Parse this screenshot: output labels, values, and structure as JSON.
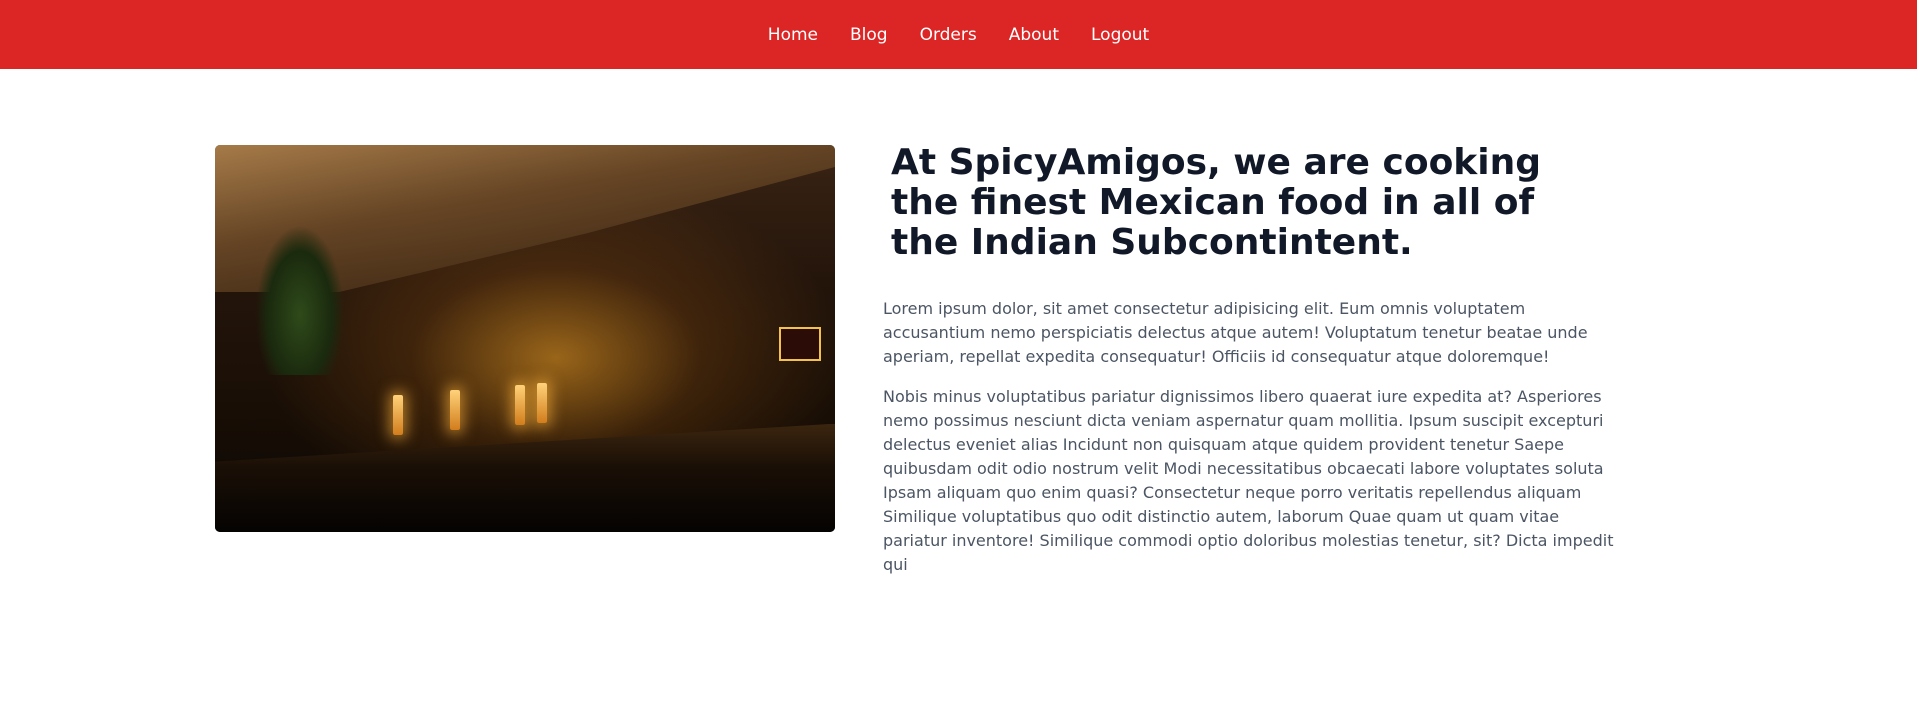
{
  "nav": {
    "items": [
      {
        "label": "Home"
      },
      {
        "label": "Blog"
      },
      {
        "label": "Orders"
      },
      {
        "label": "About"
      },
      {
        "label": "Logout"
      }
    ]
  },
  "main": {
    "heading": "At SpicyAmigos, we are cooking the finest Mexican food in all of the Indian Subcontintent.",
    "paragraphs": [
      "Lorem ipsum dolor, sit amet consectetur adipisicing elit. Eum omnis voluptatem accusantium nemo perspiciatis delectus atque autem! Voluptatum tenetur beatae unde aperiam, repellat expedita consequatur! Officiis id consequatur atque doloremque!",
      "Nobis minus voluptatibus pariatur dignissimos libero quaerat iure expedita at? Asperiores nemo possimus nesciunt dicta veniam aspernatur quam mollitia. Ipsum suscipit excepturi delectus eveniet alias Incidunt non quisquam atque quidem provident tenetur Saepe quibusdam odit odio nostrum velit Modi necessitatibus obcaecati labore voluptates soluta Ipsam aliquam quo enim quasi? Consectetur neque porro veritatis repellendus aliquam Similique voluptatibus quo odit distinctio autem, laborum Quae quam ut quam vitae pariatur inventore! Similique commodi optio doloribus molestias tenetur, sit? Dicta impedit qui"
    ]
  },
  "colors": {
    "navbar": "#dc2626",
    "heading": "#111827",
    "body_text": "#4b5563"
  }
}
